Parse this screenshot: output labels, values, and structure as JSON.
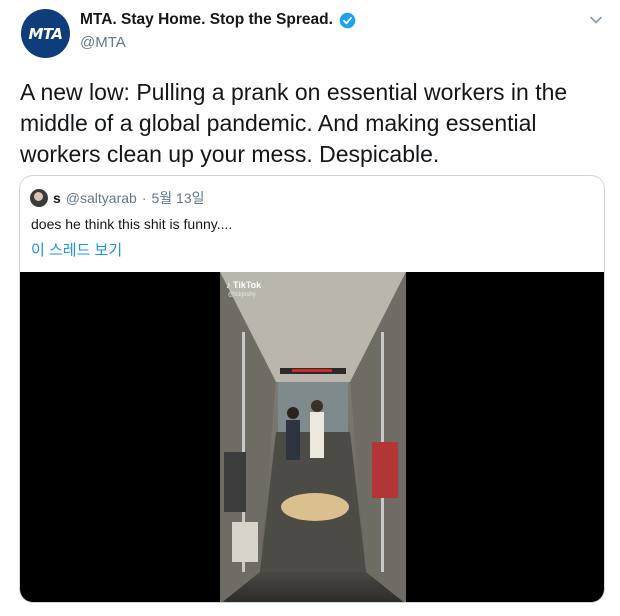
{
  "author": {
    "name": "MTA. Stay Home. Stop the Spread.",
    "handle": "@MTA",
    "avatar_text": "MTA",
    "verified": true
  },
  "tweet": {
    "text": "A new low: Pulling a prank on essential workers in the middle of a global pandemic. And making essential workers clean up your mess. Despicable."
  },
  "quoted": {
    "name": "s",
    "handle": "@saltyarab",
    "separator": "·",
    "date": "5월 13일",
    "text": "does he think this shit is funny....",
    "thread_link": "이 스레드 보기"
  },
  "media": {
    "tiktok_label": "TikTok",
    "tiktok_handle": "@tckjoshy"
  },
  "colors": {
    "link": "#1b95e0",
    "secondary_text": "#657786",
    "border": "#ccd6dd",
    "verified": "#1da1f2",
    "mta_brand": "#0f3c7a"
  }
}
